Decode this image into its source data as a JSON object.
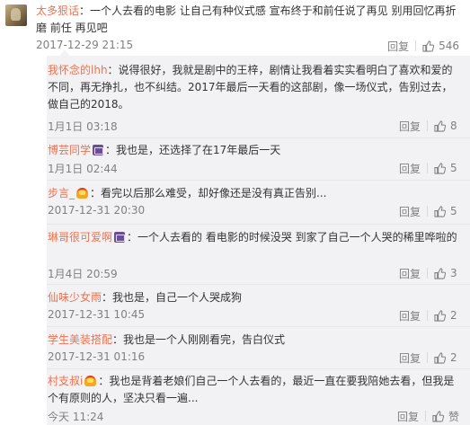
{
  "main_comment": {
    "user": "太多狠话",
    "text": "：一个人去看的电影  让自己有种仪式感 宣布终于和前任说了再见  别用回忆再折磨  前任  再见吧",
    "time": "2017-12-29 21:15",
    "reply_label": "回复",
    "like_count": "546"
  },
  "replies": [
    {
      "user": "我怀念的lhh",
      "text": "：说得很好，我就是剧中的王梓，剧情让我看着实实看明白了喜欢和爱的不同，再无挣扎，也不纠结。2017年最后一天看的这部剧，像一场仪式，告别过去，做自己的2018。",
      "time": "1月1日 03:18",
      "reply_label": "回复",
      "like_count": "8"
    },
    {
      "user": "博芸同学",
      "text": "：我也是，还选择了在17年最后一天",
      "time": "1月1日 02:44",
      "reply_label": "回复",
      "like_count": "5"
    },
    {
      "user": "步言_",
      "text": "：看完以后那么难受，却好像还是没有真正告别...",
      "time": "2017-12-31 20:30",
      "reply_label": "回复",
      "like_count": "5"
    },
    {
      "user": "琳哥很可爱啊",
      "text": "：一个人去看的  看电影的时候没哭  到家了自己一个人哭的稀里哗啦的",
      "time": "1月4日 20:59",
      "reply_label": "回复",
      "like_count": "3"
    },
    {
      "user": "仙味少女雨",
      "text": "：我也是，自己一个人哭成狗",
      "time": "2017-12-31 10:45",
      "reply_label": "回复",
      "like_count": "2"
    },
    {
      "user": "学生美装搭配",
      "text": "：我也是一个人刚刚看完，告白仪式",
      "time": "2017-12-31 01:16",
      "reply_label": "回复",
      "like_count": "2"
    },
    {
      "user": "村支叔i",
      "text": "：我也是背着老娘们自己一个人去看的，最近一直在要我陪她去看，但我是个有原则的人，坚决只看一遍...",
      "time": "今天 11:24",
      "reply_label": "回复",
      "like_count": "赞"
    }
  ]
}
